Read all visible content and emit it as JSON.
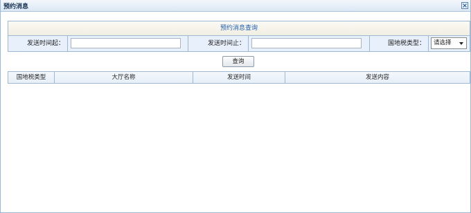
{
  "window": {
    "title": "预约消息"
  },
  "query": {
    "header": "预约消息查询",
    "send_time_from_label": "发送时间起：",
    "send_time_from_value": "",
    "send_time_to_label": "发送时间止：",
    "send_time_to_value": "",
    "tax_type_label": "国地税类型：",
    "tax_type_selected": "请选择",
    "search_button": "查询"
  },
  "grid": {
    "columns": [
      "国地税类型",
      "大厅名称",
      "发送时间",
      "发送内容"
    ],
    "rows": []
  },
  "colors": {
    "border": "#9db8d6",
    "header_text": "#1f5fb3",
    "row_bg": "#e8f1fb"
  },
  "icons": {
    "close": "close-icon",
    "dropdown": "chevron-down-icon"
  }
}
